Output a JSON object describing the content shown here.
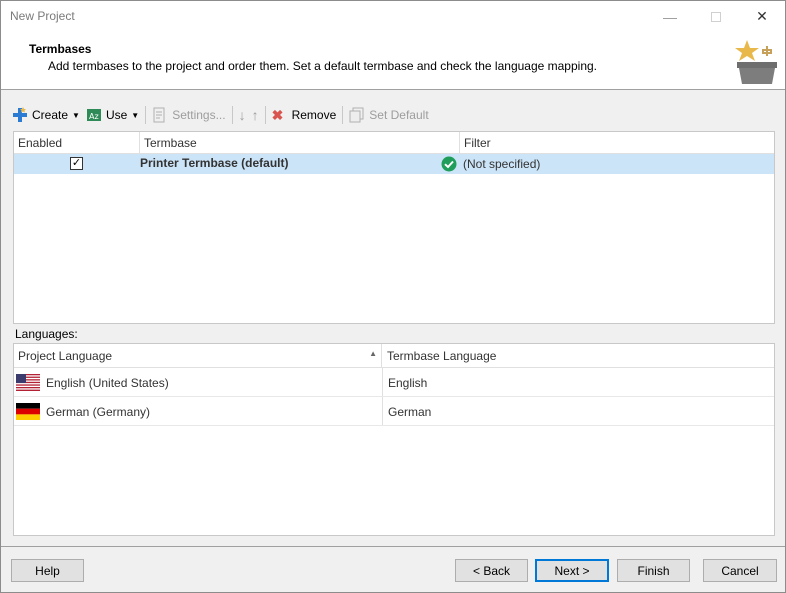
{
  "window": {
    "title": "New Project"
  },
  "header": {
    "title": "Termbases",
    "description": "Add termbases to the project and order them. Set a default termbase and check the language mapping."
  },
  "toolbar": {
    "create": "Create",
    "use": "Use",
    "settings": "Settings...",
    "remove": "Remove",
    "set_default": "Set Default"
  },
  "termbase_grid": {
    "columns": [
      "Enabled",
      "Termbase",
      "Filter"
    ],
    "rows": [
      {
        "enabled": true,
        "termbase": "Printer Termbase (default)",
        "filter": "(Not specified)"
      }
    ]
  },
  "languages": {
    "label": "Languages:",
    "columns": [
      "Project Language",
      "Termbase Language"
    ],
    "rows": [
      {
        "project_language": "English (United States)",
        "termbase_language": "English",
        "flag": "us-flag-icon"
      },
      {
        "project_language": "German (Germany)",
        "termbase_language": "German",
        "flag": "de-flag-icon"
      }
    ]
  },
  "footer": {
    "help": "Help",
    "back": "< Back",
    "next": "Next >",
    "finish": "Finish",
    "cancel": "Cancel"
  },
  "colors": {
    "selection": "#cce4f7",
    "primary_border": "#0078d7",
    "ok_green": "#1e9e5a"
  }
}
